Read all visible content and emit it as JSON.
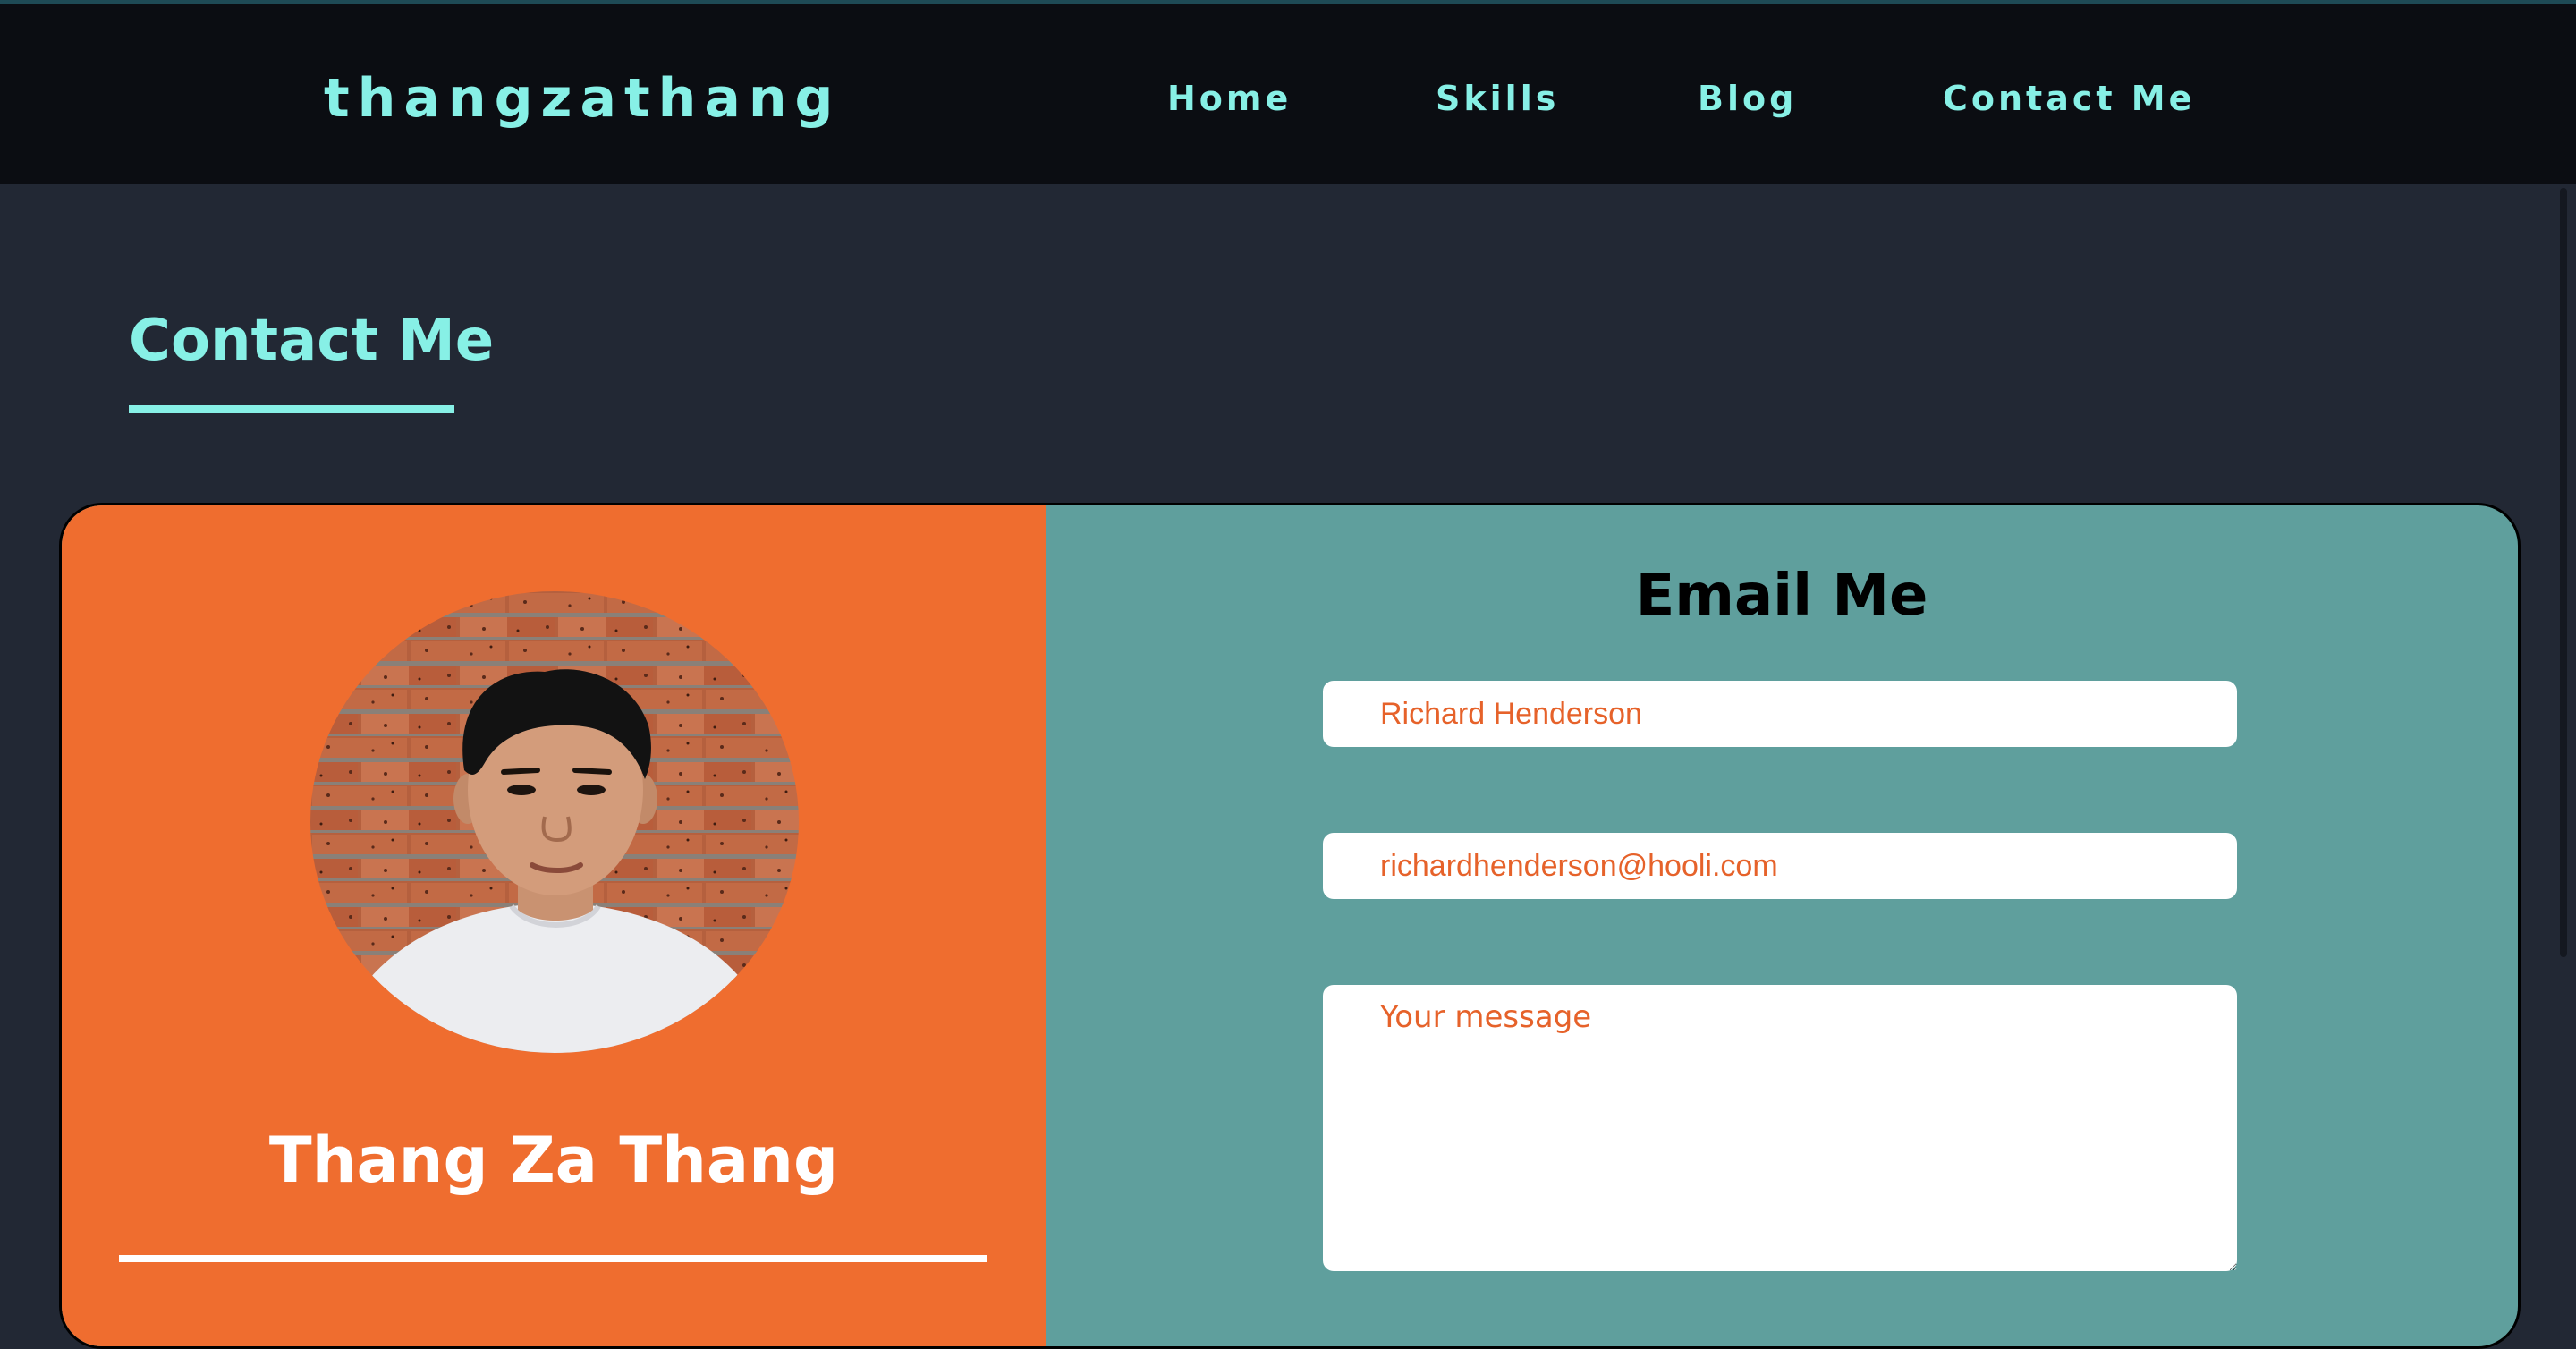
{
  "navbar": {
    "brand": "thangzathang",
    "links": [
      {
        "label": "Home"
      },
      {
        "label": "Skills"
      },
      {
        "label": "Blog"
      },
      {
        "label": "Contact Me"
      }
    ]
  },
  "page": {
    "section_title": "Contact Me"
  },
  "profile": {
    "name": "Thang Za Thang",
    "photo_icon": "profile-photo"
  },
  "form": {
    "title": "Email Me",
    "name_value": "Richard Henderson",
    "email_value": "richardhenderson@hooli.com",
    "message_value": "",
    "message_placeholder": "Your message"
  },
  "colors": {
    "accent": "#87f0e6",
    "navbar_bg": "#0b0d12",
    "page_bg": "#222834",
    "card_left": "#ef6d2f",
    "card_right": "#5f9f9d",
    "input_text": "#e6622a"
  }
}
